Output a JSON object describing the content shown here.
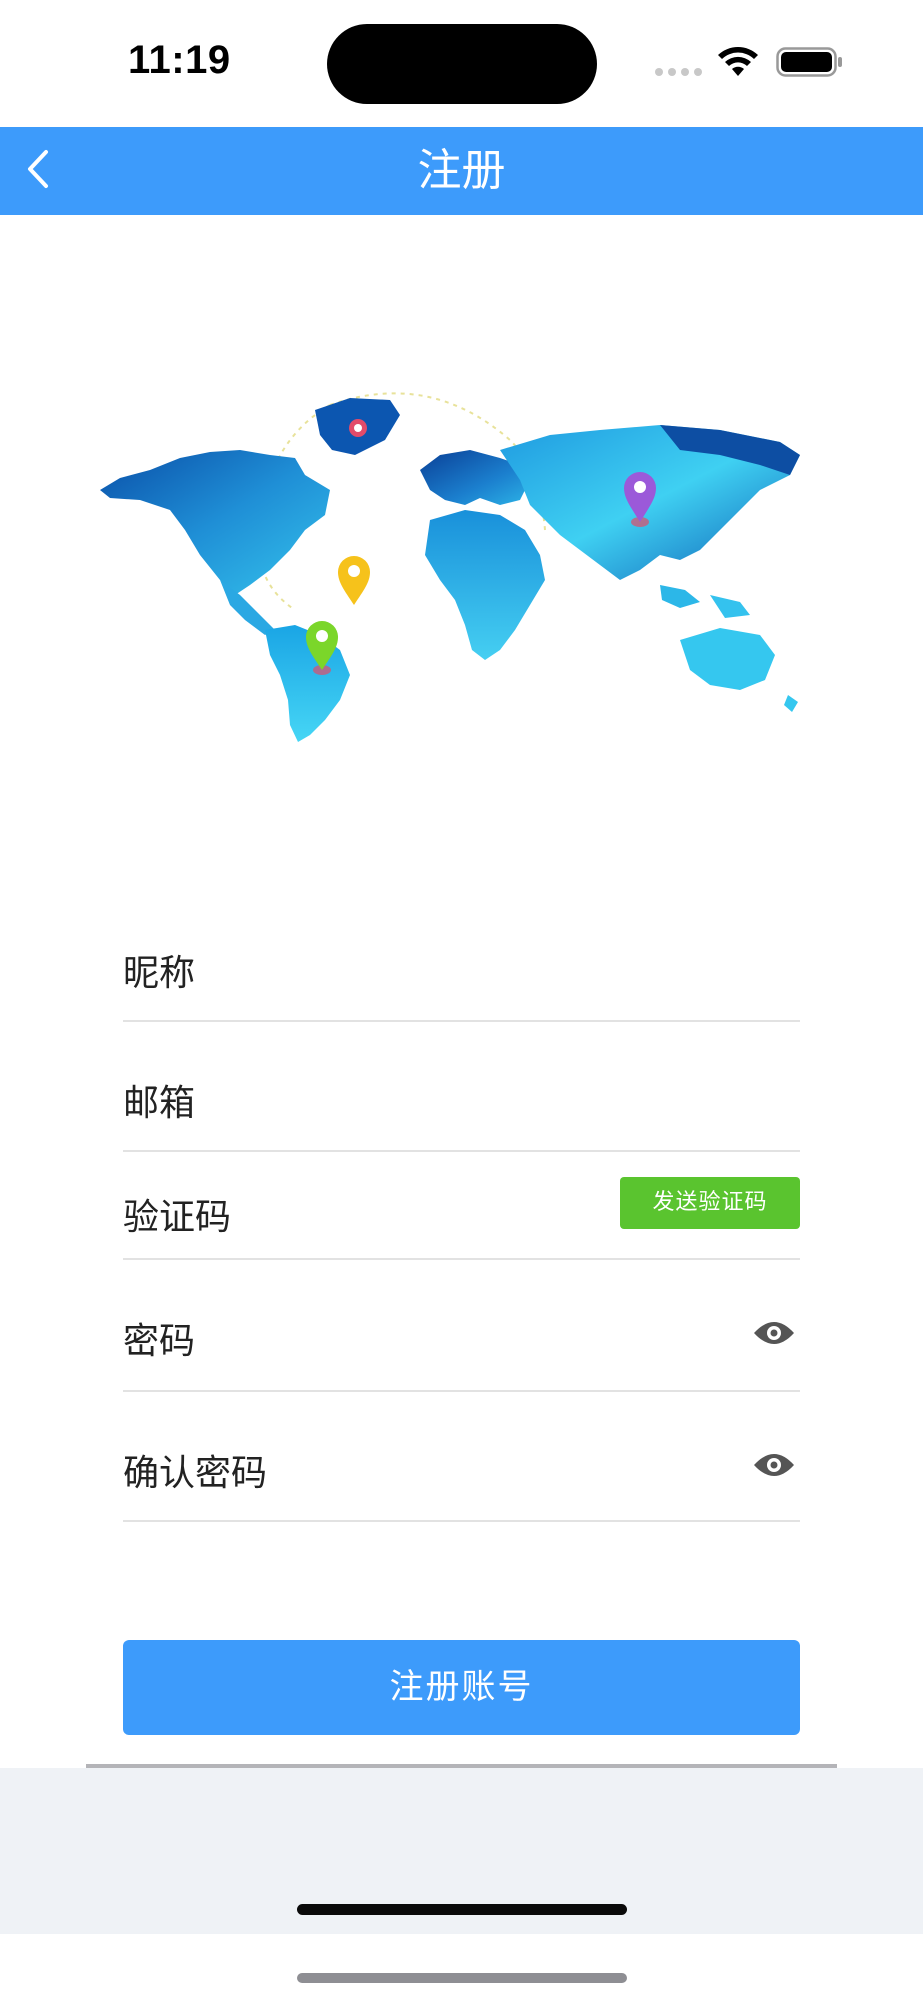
{
  "status_bar": {
    "time": "11:19"
  },
  "nav": {
    "title": "注册",
    "back_icon": "chevron-left-icon"
  },
  "illustration": {
    "icon": "world-map-illustration"
  },
  "form": {
    "nickname_label": "昵称",
    "email_label": "邮箱",
    "code_label": "验证码",
    "send_code_label": "发送验证码",
    "password_label": "密码",
    "confirm_password_label": "确认密码",
    "eye_icon": "eye-icon"
  },
  "actions": {
    "register_label": "注册账号"
  },
  "colors": {
    "primary": "#3d9bfb",
    "send_code_green": "#5ac42f",
    "divider": "#e2e2e2",
    "bottom_bg": "#eff2f6"
  }
}
